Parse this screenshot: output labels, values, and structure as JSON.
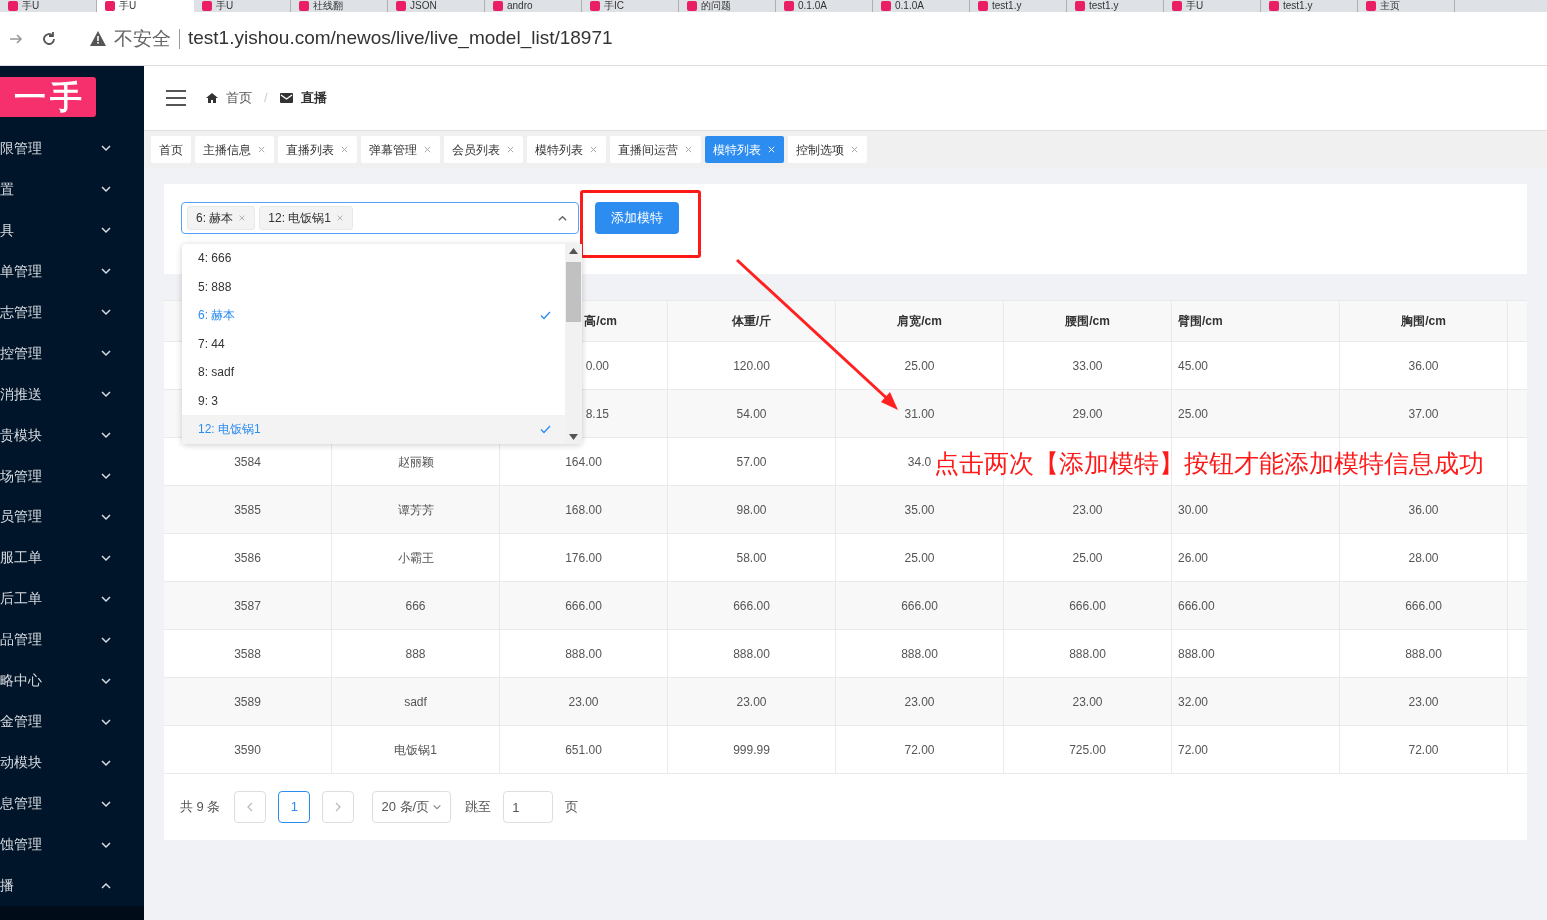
{
  "browser": {
    "tabs": [
      {
        "label": "手U",
        "selected": false
      },
      {
        "label": "手U",
        "selected": true
      },
      {
        "label": "手U",
        "selected": false
      },
      {
        "label": "社线翻",
        "selected": false
      },
      {
        "label": "JSON",
        "selected": false
      },
      {
        "label": "andro",
        "selected": false
      },
      {
        "label": "手IC",
        "selected": false
      },
      {
        "label": "的问题",
        "selected": false
      },
      {
        "label": "0.1.0A",
        "selected": false
      },
      {
        "label": "0.1.0A",
        "selected": false
      },
      {
        "label": "test1.y",
        "selected": false
      },
      {
        "label": "test1.y",
        "selected": false
      },
      {
        "label": "手U",
        "selected": false
      },
      {
        "label": "test1.y",
        "selected": false
      },
      {
        "label": "主页",
        "selected": false
      }
    ],
    "security": "不安全",
    "url": "test1.yishou.com/newos/live/live_model_list/18971"
  },
  "logo": "一手",
  "sidebar": {
    "items": [
      {
        "label": "限管理",
        "expanded": false
      },
      {
        "label": "置",
        "expanded": false
      },
      {
        "label": "具",
        "expanded": false
      },
      {
        "label": "单管理",
        "expanded": false
      },
      {
        "label": "志管理",
        "expanded": false
      },
      {
        "label": "控管理",
        "expanded": false
      },
      {
        "label": "消推送",
        "expanded": false
      },
      {
        "label": "贵模块",
        "expanded": false
      },
      {
        "label": "场管理",
        "expanded": false
      },
      {
        "label": "员管理",
        "expanded": false
      },
      {
        "label": "服工单",
        "expanded": false
      },
      {
        "label": "后工单",
        "expanded": false
      },
      {
        "label": "品管理",
        "expanded": false
      },
      {
        "label": "略中心",
        "expanded": false
      },
      {
        "label": "金管理",
        "expanded": false
      },
      {
        "label": "动模块",
        "expanded": false
      },
      {
        "label": "息管理",
        "expanded": false
      },
      {
        "label": "蚀管理",
        "expanded": false
      },
      {
        "label": "播",
        "expanded": true
      }
    ]
  },
  "breadcrumb_separator": "/",
  "breadcrumb": [
    {
      "label": "首页",
      "kind": "home"
    },
    {
      "label": "直播",
      "kind": "mail"
    }
  ],
  "tabs": [
    {
      "label": "首页",
      "selected": false,
      "closable": false
    },
    {
      "label": "主播信息",
      "selected": false,
      "closable": true
    },
    {
      "label": "直播列表",
      "selected": false,
      "closable": true
    },
    {
      "label": "弹幕管理",
      "selected": false,
      "closable": true
    },
    {
      "label": "会员列表",
      "selected": false,
      "closable": true
    },
    {
      "label": "模特列表",
      "selected": false,
      "closable": true
    },
    {
      "label": "直播间运营",
      "selected": false,
      "closable": true
    },
    {
      "label": "模特列表",
      "selected": true,
      "closable": true
    },
    {
      "label": "控制选项",
      "selected": false,
      "closable": true
    }
  ],
  "select": {
    "tags": [
      "6: 赫本",
      "12: 电饭锅1"
    ],
    "options": [
      {
        "label": "4: 666",
        "selected": false
      },
      {
        "label": "5: 888",
        "selected": false
      },
      {
        "label": "6: 赫本",
        "selected": true
      },
      {
        "label": "7: 44",
        "selected": false
      },
      {
        "label": "8: sadf",
        "selected": false
      },
      {
        "label": "9: 3",
        "selected": false
      },
      {
        "label": "12: 电饭锅1",
        "selected": true
      }
    ]
  },
  "add_button": "添加模特",
  "table": {
    "columns": [
      null,
      null,
      "高/cm",
      "体重/斤",
      "肩宽/cm",
      "腰围/cm",
      "臂围/cm",
      "胸围/cm"
    ],
    "rows": [
      [
        null,
        null,
        "0.00",
        "120.00",
        "25.00",
        "33.00",
        "45.00",
        "36.00"
      ],
      [
        null,
        null,
        "8.15",
        "54.00",
        "31.00",
        "29.00",
        "25.00",
        "37.00"
      ],
      [
        "3584",
        "赵丽颖",
        "164.00",
        "57.00",
        "34.0",
        null,
        null,
        null
      ],
      [
        "3585",
        "谭芳芳",
        "168.00",
        "98.00",
        "35.00",
        "23.00",
        "30.00",
        "36.00"
      ],
      [
        "3586",
        "小霸王",
        "176.00",
        "58.00",
        "25.00",
        "25.00",
        "26.00",
        "28.00"
      ],
      [
        "3587",
        "666",
        "666.00",
        "666.00",
        "666.00",
        "666.00",
        "666.00",
        "666.00"
      ],
      [
        "3588",
        "888",
        "888.00",
        "888.00",
        "888.00",
        "888.00",
        "888.00",
        "888.00"
      ],
      [
        "3589",
        "sadf",
        "23.00",
        "23.00",
        "23.00",
        "23.00",
        "32.00",
        "23.00"
      ],
      [
        "3590",
        "电饭锅1",
        "651.00",
        "999.99",
        "72.00",
        "725.00",
        "72.00",
        "72.00"
      ]
    ]
  },
  "pagination": {
    "total": "共 9 条",
    "pages": [
      {
        "label": "1",
        "selected": true
      }
    ],
    "page_size": "20 条/页",
    "jump_label": "跳至",
    "jump_value": "1",
    "page_suffix": "页"
  },
  "annotation": "点击两次【添加模特】按钮才能添加模特信息成功"
}
